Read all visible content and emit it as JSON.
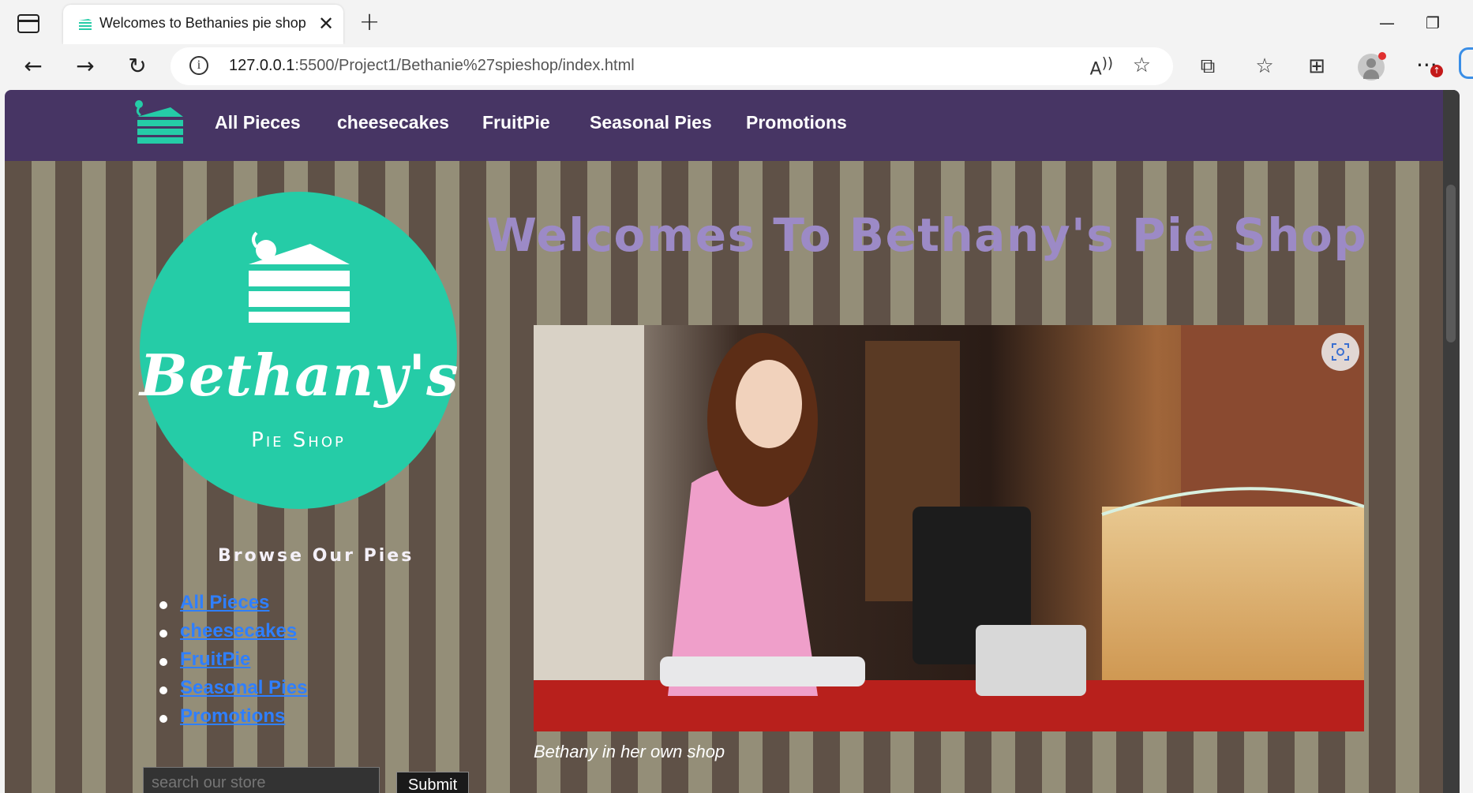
{
  "browser": {
    "tab_title": "Welcomes to Bethanies pie shop",
    "tab_close": "✕",
    "new_tab": "+",
    "url_host": "127.0.0.1",
    "url_path": ":5500/Project1/Bethanie%27spieshop/index.html",
    "more": "···",
    "update_badge": "↑"
  },
  "navbar": {
    "links": [
      "All Pieces",
      "cheesecakes",
      "FruitPie",
      "Seasonal Pies",
      "Promotions"
    ]
  },
  "logo": {
    "name": "Bethany's",
    "subtitle": "Pie Shop"
  },
  "sidebar": {
    "title": "Browse Our Pies",
    "links": [
      "All Pieces",
      "cheesecakes",
      "FruitPie",
      "Seasonal Pies",
      "Promotions"
    ]
  },
  "search": {
    "placeholder": "search our store",
    "submit_label": "Submit"
  },
  "main": {
    "title": "Welcomes To Bethany's Pie Shop",
    "caption": "Bethany in her own shop"
  },
  "colors": {
    "navbar": "#473564",
    "stripe_dark": "#5f5147",
    "stripe_light": "#948e78",
    "logo_teal": "#25cca7",
    "title_lavender": "#9c8ac6",
    "link_blue": "#2f7fff"
  }
}
